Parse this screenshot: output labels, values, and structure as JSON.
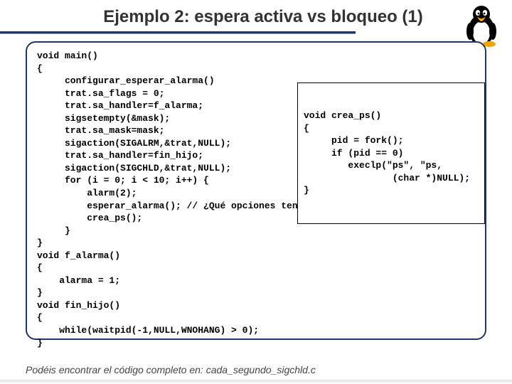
{
  "title": "Ejemplo 2: espera activa vs bloqueo (1)",
  "code_main": "void main()\n{\n     configurar_esperar_alarma()\n     trat.sa_flags = 0;\n     trat.sa_handler=f_alarma;\n     sigsetempty(&mask);\n     trat.sa_mask=mask;\n     sigaction(SIGALRM,&trat,NULL);\n     trat.sa_handler=fin_hijo;\n     sigaction(SIGCHLD,&trat,NULL);\n     for (i = 0; i < 10; i++) {\n         alarm(2);\n         esperar_alarma(); // ¿Qué opciones tenemos?\n         crea_ps();\n     }\n}\nvoid f_alarma()\n{\n    alarma = 1;\n}\nvoid fin_hijo()\n{\n    while(waitpid(-1,NULL,WNOHANG) > 0);\n}",
  "code_inset": "void crea_ps()\n{\n     pid = fork();\n     if (pid == 0)\n        execlp(\"ps\", \"ps,\n                (char *)NULL);\n}",
  "footer_prefix": "Podéis encontrar el código completo en: ",
  "footer_file": "cada_segundo_sigchld.c",
  "footer_page_overlap": "1.11",
  "icon_name": "tux-penguin"
}
